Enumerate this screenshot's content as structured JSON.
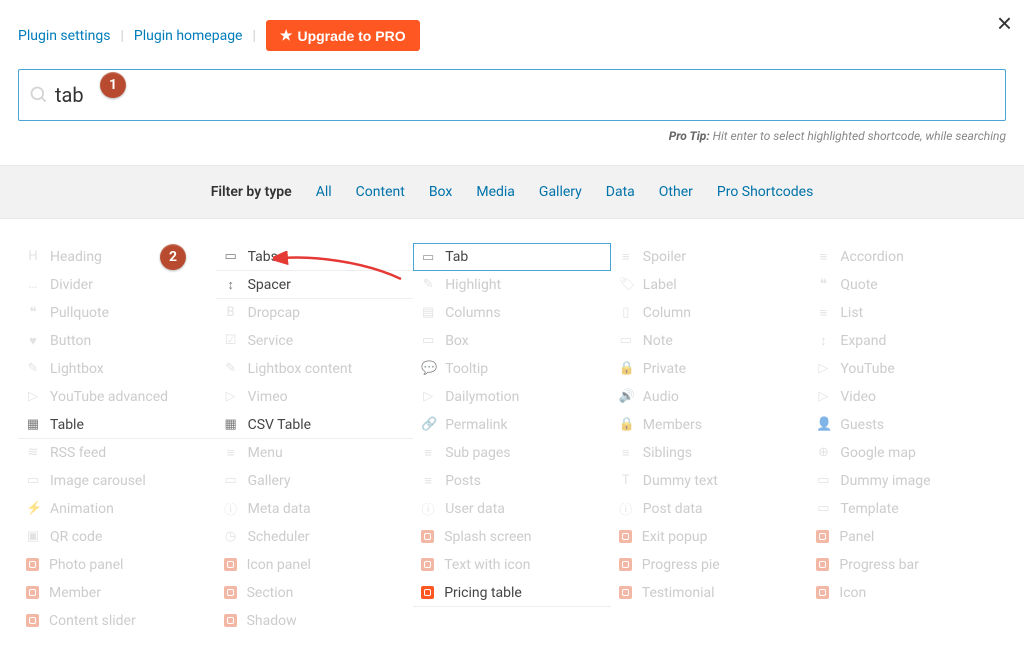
{
  "header": {
    "settings_link": "Plugin settings",
    "homepage_link": "Plugin homepage",
    "upgrade_label": "Upgrade to PRO"
  },
  "search": {
    "value": "tab"
  },
  "pro_tip": {
    "label": "Pro Tip:",
    "text": "Hit enter to select highlighted shortcode, while searching"
  },
  "filters": {
    "label": "Filter by type",
    "items": [
      "All",
      "Content",
      "Box",
      "Media",
      "Gallery",
      "Data",
      "Other",
      "Pro Shortcodes"
    ]
  },
  "shortcodes": {
    "cols": [
      [
        {
          "icon": "H",
          "label": "Heading"
        },
        {
          "icon": "…",
          "label": "Divider"
        },
        {
          "icon": "❝",
          "label": "Pullquote"
        },
        {
          "icon": "♥",
          "label": "Button"
        },
        {
          "icon": "✎",
          "label": "Lightbox"
        },
        {
          "icon": "▷",
          "label": "YouTube advanced"
        },
        {
          "icon": "▦",
          "label": "Table",
          "match": true
        },
        {
          "icon": "≋",
          "label": "RSS feed"
        },
        {
          "icon": "▭",
          "label": "Image carousel"
        },
        {
          "icon": "⚡",
          "label": "Animation"
        },
        {
          "icon": "▣",
          "label": "QR code"
        },
        {
          "icon": "pro",
          "label": "Photo panel"
        },
        {
          "icon": "pro",
          "label": "Member"
        },
        {
          "icon": "pro",
          "label": "Content slider"
        }
      ],
      [
        {
          "icon": "▭",
          "label": "Tabs",
          "match": true
        },
        {
          "icon": "↕",
          "label": "Spacer",
          "match": true
        },
        {
          "icon": "B",
          "label": "Dropcap"
        },
        {
          "icon": "☑",
          "label": "Service"
        },
        {
          "icon": "✎",
          "label": "Lightbox content"
        },
        {
          "icon": "▷",
          "label": "Vimeo"
        },
        {
          "icon": "▦",
          "label": "CSV Table",
          "match": true
        },
        {
          "icon": "≡",
          "label": "Menu"
        },
        {
          "icon": "▭",
          "label": "Gallery"
        },
        {
          "icon": "ⓘ",
          "label": "Meta data"
        },
        {
          "icon": "◷",
          "label": "Scheduler"
        },
        {
          "icon": "pro",
          "label": "Icon panel"
        },
        {
          "icon": "pro",
          "label": "Section"
        },
        {
          "icon": "pro",
          "label": "Shadow"
        }
      ],
      [
        {
          "icon": "▭",
          "label": "Tab",
          "highlighted": true
        },
        {
          "icon": "✎",
          "label": "Highlight"
        },
        {
          "icon": "▤",
          "label": "Columns"
        },
        {
          "icon": "▭",
          "label": "Box"
        },
        {
          "icon": "💬",
          "label": "Tooltip"
        },
        {
          "icon": "▷",
          "label": "Dailymotion"
        },
        {
          "icon": "🔗",
          "label": "Permalink"
        },
        {
          "icon": "≡",
          "label": "Sub pages"
        },
        {
          "icon": "≡",
          "label": "Posts"
        },
        {
          "icon": "ⓘ",
          "label": "User data"
        },
        {
          "icon": "pro",
          "label": "Splash screen"
        },
        {
          "icon": "pro",
          "label": "Text with icon"
        },
        {
          "icon": "pro",
          "label": "Pricing table",
          "match": true
        }
      ],
      [
        {
          "icon": "≡",
          "label": "Spoiler"
        },
        {
          "icon": "🏷",
          "label": "Label"
        },
        {
          "icon": "▯",
          "label": "Column"
        },
        {
          "icon": "▭",
          "label": "Note"
        },
        {
          "icon": "🔒",
          "label": "Private"
        },
        {
          "icon": "🔊",
          "label": "Audio"
        },
        {
          "icon": "🔒",
          "label": "Members"
        },
        {
          "icon": "≡",
          "label": "Siblings"
        },
        {
          "icon": "T",
          "label": "Dummy text"
        },
        {
          "icon": "ⓘ",
          "label": "Post data"
        },
        {
          "icon": "pro",
          "label": "Exit popup"
        },
        {
          "icon": "pro",
          "label": "Progress pie"
        },
        {
          "icon": "pro",
          "label": "Testimonial"
        }
      ],
      [
        {
          "icon": "≡",
          "label": "Accordion"
        },
        {
          "icon": "❝",
          "label": "Quote"
        },
        {
          "icon": "≡",
          "label": "List"
        },
        {
          "icon": "↕",
          "label": "Expand"
        },
        {
          "icon": "▷",
          "label": "YouTube"
        },
        {
          "icon": "▷",
          "label": "Video"
        },
        {
          "icon": "👤",
          "label": "Guests"
        },
        {
          "icon": "⊕",
          "label": "Google map"
        },
        {
          "icon": "▭",
          "label": "Dummy image"
        },
        {
          "icon": "▭",
          "label": "Template"
        },
        {
          "icon": "pro",
          "label": "Panel"
        },
        {
          "icon": "pro",
          "label": "Progress bar"
        },
        {
          "icon": "pro",
          "label": "Icon"
        }
      ]
    ]
  },
  "annotations": {
    "c1": "1",
    "c2": "2"
  }
}
